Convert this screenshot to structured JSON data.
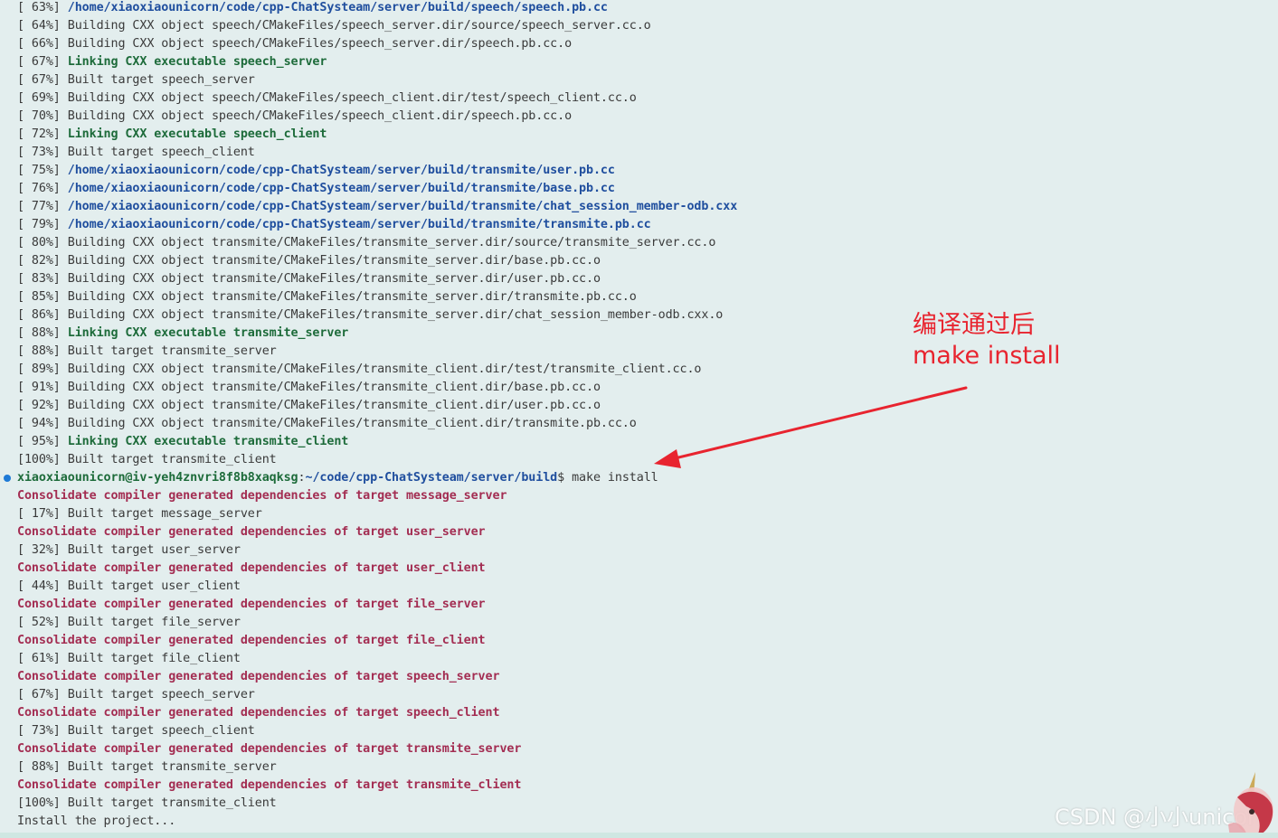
{
  "terminal": {
    "lines": [
      {
        "type": "path",
        "pct": "[ 63%] ",
        "text": "/home/xiaoxiaounicorn/code/cpp-ChatSysteam/server/build/speech/speech.pb.cc"
      },
      {
        "type": "plain",
        "pct": "[ 64%] ",
        "text": "Building CXX object speech/CMakeFiles/speech_server.dir/source/speech_server.cc.o"
      },
      {
        "type": "plain",
        "pct": "[ 66%] ",
        "text": "Building CXX object speech/CMakeFiles/speech_server.dir/speech.pb.cc.o"
      },
      {
        "type": "link",
        "pct": "[ 67%] ",
        "text": "Linking CXX executable speech_server"
      },
      {
        "type": "plain",
        "pct": "[ 67%] ",
        "text": "Built target speech_server"
      },
      {
        "type": "plain",
        "pct": "[ 69%] ",
        "text": "Building CXX object speech/CMakeFiles/speech_client.dir/test/speech_client.cc.o"
      },
      {
        "type": "plain",
        "pct": "[ 70%] ",
        "text": "Building CXX object speech/CMakeFiles/speech_client.dir/speech.pb.cc.o"
      },
      {
        "type": "link",
        "pct": "[ 72%] ",
        "text": "Linking CXX executable speech_client"
      },
      {
        "type": "plain",
        "pct": "[ 73%] ",
        "text": "Built target speech_client"
      },
      {
        "type": "path",
        "pct": "[ 75%] ",
        "text": "/home/xiaoxiaounicorn/code/cpp-ChatSysteam/server/build/transmite/user.pb.cc"
      },
      {
        "type": "path",
        "pct": "[ 76%] ",
        "text": "/home/xiaoxiaounicorn/code/cpp-ChatSysteam/server/build/transmite/base.pb.cc"
      },
      {
        "type": "path",
        "pct": "[ 77%] ",
        "text": "/home/xiaoxiaounicorn/code/cpp-ChatSysteam/server/build/transmite/chat_session_member-odb.cxx"
      },
      {
        "type": "path",
        "pct": "[ 79%] ",
        "text": "/home/xiaoxiaounicorn/code/cpp-ChatSysteam/server/build/transmite/transmite.pb.cc"
      },
      {
        "type": "plain",
        "pct": "[ 80%] ",
        "text": "Building CXX object transmite/CMakeFiles/transmite_server.dir/source/transmite_server.cc.o"
      },
      {
        "type": "plain",
        "pct": "[ 82%] ",
        "text": "Building CXX object transmite/CMakeFiles/transmite_server.dir/base.pb.cc.o"
      },
      {
        "type": "plain",
        "pct": "[ 83%] ",
        "text": "Building CXX object transmite/CMakeFiles/transmite_server.dir/user.pb.cc.o"
      },
      {
        "type": "plain",
        "pct": "[ 85%] ",
        "text": "Building CXX object transmite/CMakeFiles/transmite_server.dir/transmite.pb.cc.o"
      },
      {
        "type": "plain",
        "pct": "[ 86%] ",
        "text": "Building CXX object transmite/CMakeFiles/transmite_server.dir/chat_session_member-odb.cxx.o"
      },
      {
        "type": "link",
        "pct": "[ 88%] ",
        "text": "Linking CXX executable transmite_server"
      },
      {
        "type": "plain",
        "pct": "[ 88%] ",
        "text": "Built target transmite_server"
      },
      {
        "type": "plain",
        "pct": "[ 89%] ",
        "text": "Building CXX object transmite/CMakeFiles/transmite_client.dir/test/transmite_client.cc.o"
      },
      {
        "type": "plain",
        "pct": "[ 91%] ",
        "text": "Building CXX object transmite/CMakeFiles/transmite_client.dir/base.pb.cc.o"
      },
      {
        "type": "plain",
        "pct": "[ 92%] ",
        "text": "Building CXX object transmite/CMakeFiles/transmite_client.dir/user.pb.cc.o"
      },
      {
        "type": "plain",
        "pct": "[ 94%] ",
        "text": "Building CXX object transmite/CMakeFiles/transmite_client.dir/transmite.pb.cc.o"
      },
      {
        "type": "link",
        "pct": "[ 95%] ",
        "text": "Linking CXX executable transmite_client"
      },
      {
        "type": "plain",
        "pct": "[100%] ",
        "text": "Built target transmite_client"
      },
      {
        "type": "prompt",
        "user": "xiaoxiaounicorn@iv-yeh4znvri8f8b8xaqksg",
        "sep": ":",
        "cwd": "~/code/cpp-ChatSysteam/server/build",
        "cmd": "$ make install"
      },
      {
        "type": "consol",
        "pct": "",
        "text": "Consolidate compiler generated dependencies of target message_server"
      },
      {
        "type": "plain",
        "pct": "[ 17%] ",
        "text": "Built target message_server"
      },
      {
        "type": "consol",
        "pct": "",
        "text": "Consolidate compiler generated dependencies of target user_server"
      },
      {
        "type": "plain",
        "pct": "[ 32%] ",
        "text": "Built target user_server"
      },
      {
        "type": "consol",
        "pct": "",
        "text": "Consolidate compiler generated dependencies of target user_client"
      },
      {
        "type": "plain",
        "pct": "[ 44%] ",
        "text": "Built target user_client"
      },
      {
        "type": "consol",
        "pct": "",
        "text": "Consolidate compiler generated dependencies of target file_server"
      },
      {
        "type": "plain",
        "pct": "[ 52%] ",
        "text": "Built target file_server"
      },
      {
        "type": "consol",
        "pct": "",
        "text": "Consolidate compiler generated dependencies of target file_client"
      },
      {
        "type": "plain",
        "pct": "[ 61%] ",
        "text": "Built target file_client"
      },
      {
        "type": "consol",
        "pct": "",
        "text": "Consolidate compiler generated dependencies of target speech_server"
      },
      {
        "type": "plain",
        "pct": "[ 67%] ",
        "text": "Built target speech_server"
      },
      {
        "type": "consol",
        "pct": "",
        "text": "Consolidate compiler generated dependencies of target speech_client"
      },
      {
        "type": "plain",
        "pct": "[ 73%] ",
        "text": "Built target speech_client"
      },
      {
        "type": "consol",
        "pct": "",
        "text": "Consolidate compiler generated dependencies of target transmite_server"
      },
      {
        "type": "plain",
        "pct": "[ 88%] ",
        "text": "Built target transmite_server"
      },
      {
        "type": "consol",
        "pct": "",
        "text": "Consolidate compiler generated dependencies of target transmite_client"
      },
      {
        "type": "plain",
        "pct": "[100%] ",
        "text": "Built target transmite_client"
      },
      {
        "type": "plain",
        "pct": "",
        "text": "Install the project..."
      }
    ]
  },
  "annotation": {
    "line1": "编译通过后",
    "line2": "make install"
  },
  "watermark": {
    "text": "CSDN @小小unicorn"
  },
  "colors": {
    "background": "#e3eeee",
    "path": "#1f4e9e",
    "link": "#1d6b3a",
    "consolidate": "#a32d52",
    "annotation": "#e8242f",
    "prompt_dot": "#1e7ad6"
  }
}
